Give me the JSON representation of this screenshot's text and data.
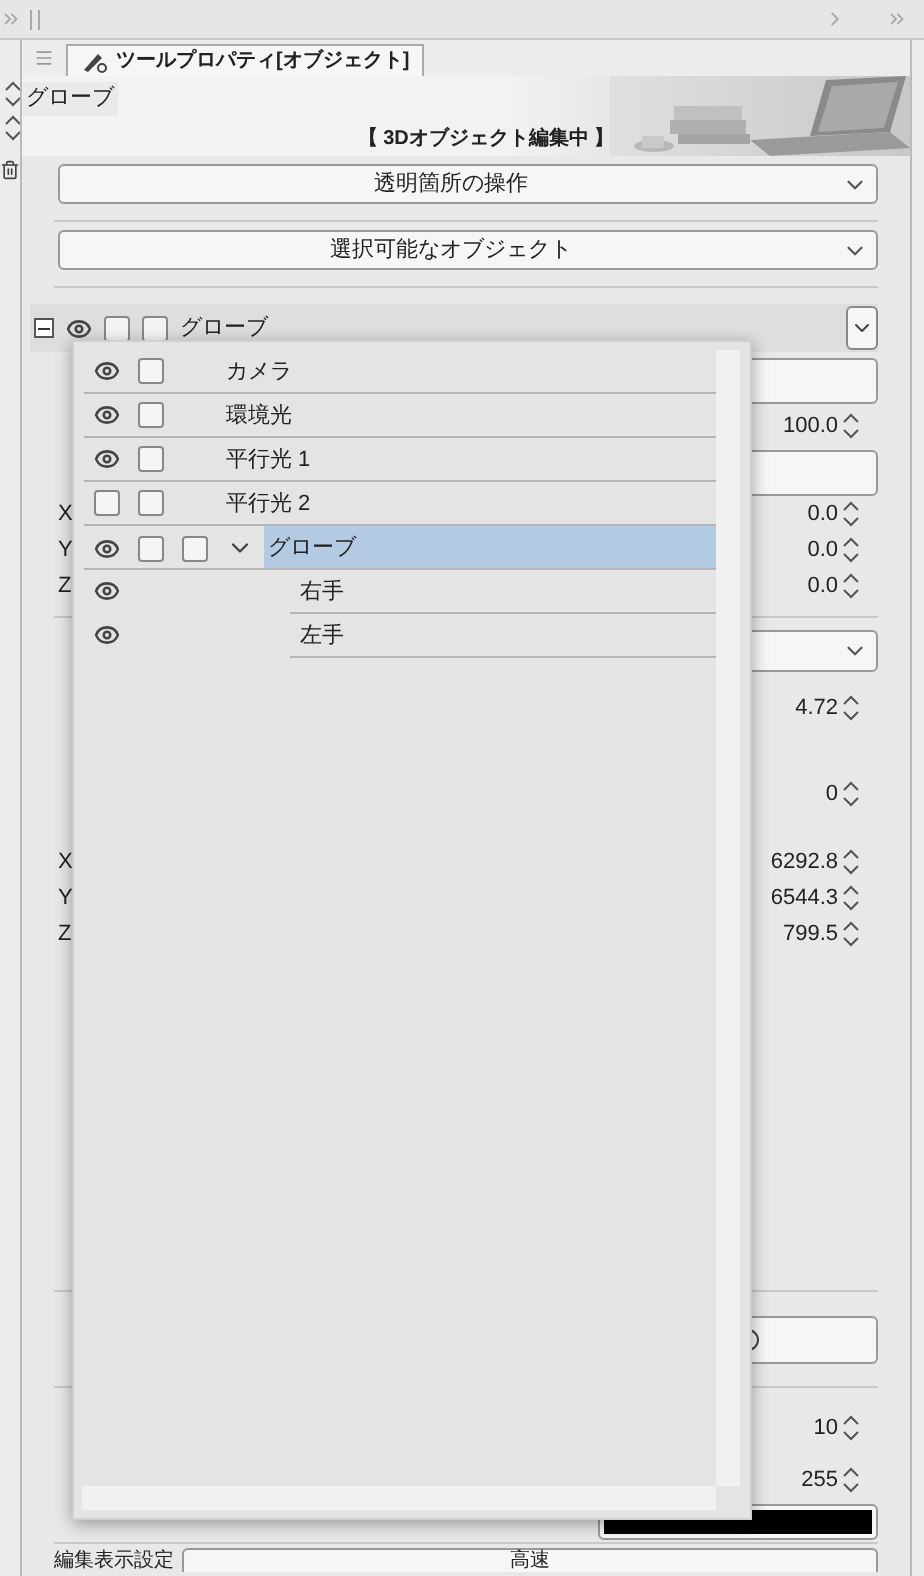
{
  "panel": {
    "tab_label": "ツールプロパティ[オブジェクト]",
    "object_name": "グローブ",
    "banner_caption": "【 3Dオブジェクト編集中 】"
  },
  "dropdowns": [
    "透明箇所の操作",
    "選択可能なオブジェクト"
  ],
  "group_header": {
    "label": "グローブ",
    "visible": true,
    "expanded": true,
    "checks": [
      false,
      false
    ]
  },
  "scale_value": "100.0",
  "position_rows": [
    {
      "axis": "X",
      "value": "0.0"
    },
    {
      "axis": "Y",
      "value": "0.0"
    },
    {
      "axis": "Z",
      "value": "0.0"
    }
  ],
  "angle_value": "4.72",
  "roll_value": "0",
  "camera_rows": [
    {
      "axis": "X",
      "value": "6292.8"
    },
    {
      "axis": "Y",
      "value": "6544.3"
    },
    {
      "axis": "Z",
      "value": "799.5"
    }
  ],
  "line_width_value": "10",
  "opacity_value": "255",
  "display_setting": {
    "label": "編集表示設定",
    "value": "高速"
  },
  "object_list": [
    {
      "name": "カメラ",
      "visible": true,
      "checks": [
        false
      ],
      "selected": false
    },
    {
      "name": "環境光",
      "visible": true,
      "checks": [
        false
      ],
      "selected": false
    },
    {
      "name": "平行光 1",
      "visible": true,
      "checks": [
        false
      ],
      "selected": false
    },
    {
      "name": "平行光 2",
      "visible": false,
      "checks": [
        false
      ],
      "selected": false
    },
    {
      "name": "グローブ",
      "visible": true,
      "checks": [
        false,
        false
      ],
      "selected": true,
      "expanded": true,
      "children": [
        {
          "name": "右手",
          "visible": true,
          "selected": false
        },
        {
          "name": "左手",
          "visible": true,
          "selected": false
        }
      ]
    }
  ]
}
